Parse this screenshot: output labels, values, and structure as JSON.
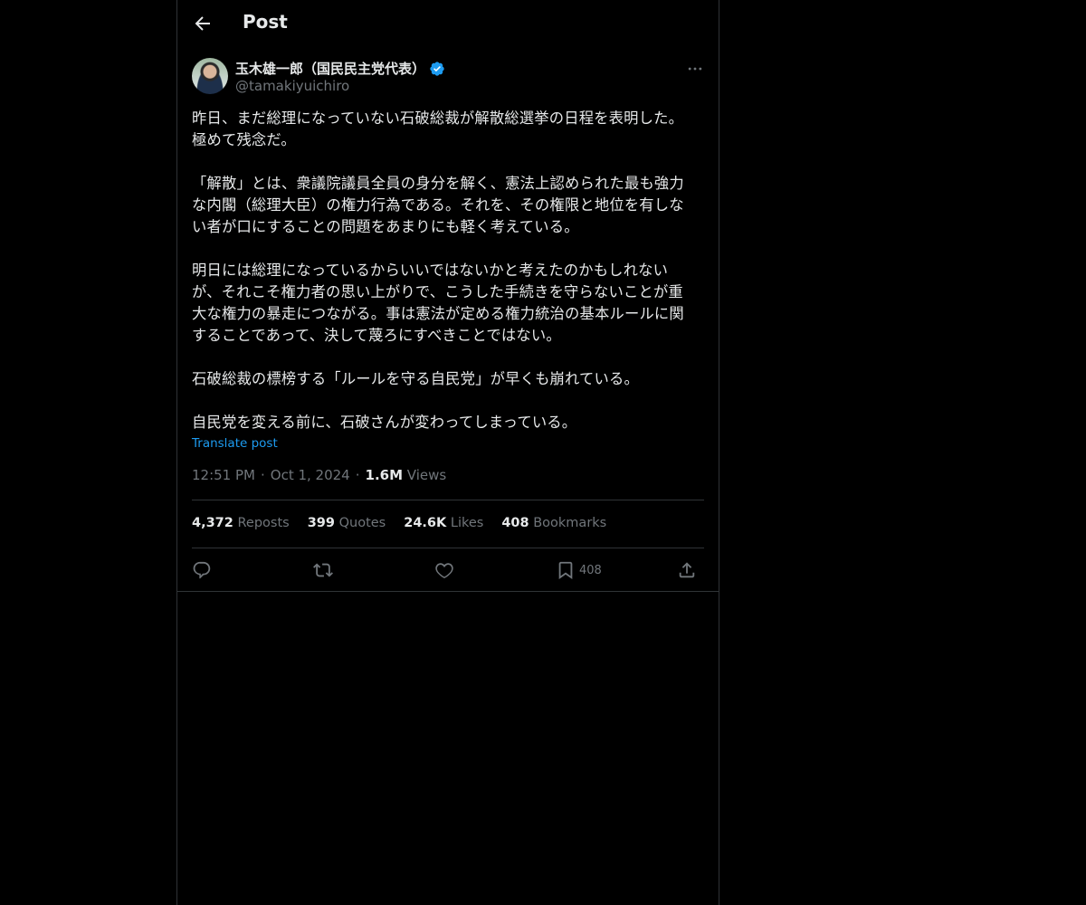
{
  "header": {
    "title": "Post",
    "back_icon": "arrow-left-icon"
  },
  "author": {
    "name": "玉木雄一郎（国民民主党代表）",
    "handle": "@tamakiyuichiro",
    "verified_icon": "verified-badge-icon",
    "verified_color": "#1d9bf0"
  },
  "post": {
    "text": "昨日、まだ総理になっていない石破総裁が解散総選挙の日程を表明した。\n極めて残念だ。\n\n「解散」とは、衆議院議員全員の身分を解く、憲法上認められた最も強力\nな内閣（総理大臣）の権力行為である。それを、その権限と地位を有しな\nい者が口にすることの問題をあまりにも軽く考えている。\n\n明日には総理になっているからいいではないかと考えたのかもしれない\nが、それこそ権力者の思い上がりで、こうした手続きを守らないことが重\n大な権力の暴走につながる。事は憲法が定める権力統治の基本ルールに関\nすることであって、決して蔑ろにすべきことではない。\n\n石破総裁の標榜する「ルールを守る自民党」が早くも崩れている。\n\n自民党を変える前に、石破さんが変わってしまっている。",
    "translate_label": "Translate post",
    "time": "12:51 PM",
    "separator": "·",
    "date": "Oct 1, 2024",
    "views_count": "1.6M",
    "views_label": "Views"
  },
  "stats": {
    "reposts_count": "4,372",
    "reposts_label": "Reposts",
    "quotes_count": "399",
    "quotes_label": "Quotes",
    "likes_count": "24.6K",
    "likes_label": "Likes",
    "bookmarks_count": "408",
    "bookmarks_label": "Bookmarks"
  },
  "actions": {
    "bookmark_count": "408"
  },
  "colors": {
    "background": "#000000",
    "text": "#e7e9ea",
    "muted": "#71767b",
    "accent": "#1d9bf0",
    "border": "#2f3336"
  }
}
